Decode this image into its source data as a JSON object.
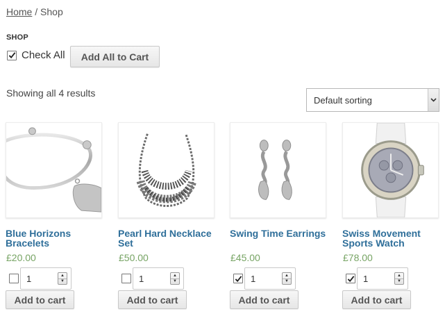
{
  "breadcrumb": {
    "home": "Home",
    "separator": " / ",
    "current": "Shop"
  },
  "shop_title": "SHOP",
  "check_all": {
    "label": "Check All",
    "checked": true
  },
  "add_all_button": "Add All to Cart",
  "result_count": "Showing all 4 results",
  "sorting": {
    "selected": "Default sorting"
  },
  "colors": {
    "link": "#2f6f9a",
    "price": "#77a464",
    "text": "#3d3d3d"
  },
  "products": [
    {
      "name": "Blue Horizons Bracelets",
      "price": "£20.00",
      "checked": false,
      "quantity": "1",
      "button": "Add to cart",
      "image_icon": "bracelet-image"
    },
    {
      "name": "Pearl Hard Necklace Set",
      "price": "£50.00",
      "checked": false,
      "quantity": "1",
      "button": "Add to cart",
      "image_icon": "necklace-image"
    },
    {
      "name": "Swing Time Earrings",
      "price": "£45.00",
      "checked": true,
      "quantity": "1",
      "button": "Add to cart",
      "image_icon": "earrings-image"
    },
    {
      "name": "Swiss Movement Sports Watch",
      "price": "£78.00",
      "checked": true,
      "quantity": "1",
      "button": "Add to cart",
      "image_icon": "watch-image"
    }
  ]
}
